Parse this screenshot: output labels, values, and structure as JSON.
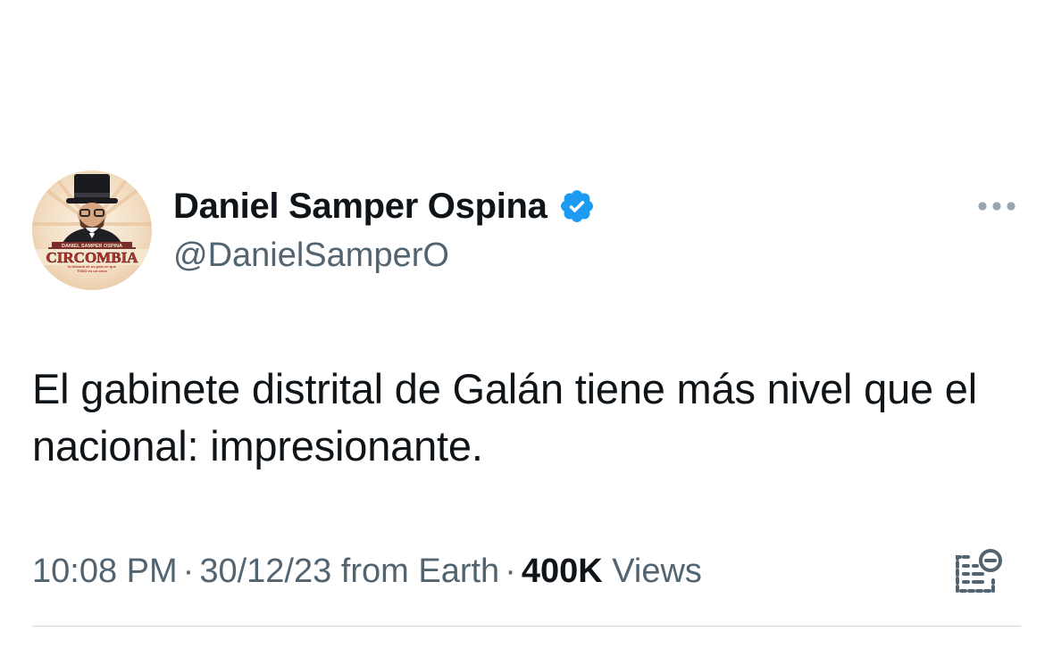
{
  "author": {
    "display_name": "Daniel Samper Ospina",
    "handle": "@DanielSamperO",
    "verified": true,
    "avatar": {
      "banner_top": "DANIEL SAMPER OSPINA",
      "banner_main": "CIRCOMBIA",
      "banner_sub": "la historia de un país en que TODO es un circo"
    }
  },
  "tweet": {
    "text": "El gabinete distrital de Galán tiene más nivel que el nacional: impresionante."
  },
  "meta": {
    "time": "10:08 PM",
    "date": "30/12/23",
    "source": "from Earth",
    "views_count": "400K",
    "views_label": "Views",
    "separator": "·"
  },
  "colors": {
    "text": "#0f1419",
    "secondary": "#536471",
    "verified_blue": "#1d9bf0",
    "divider": "#cfd9de"
  },
  "icons": {
    "more": "more-horizontal-icon",
    "verified": "verified-badge-icon",
    "edit_history": "edit-history-icon"
  }
}
